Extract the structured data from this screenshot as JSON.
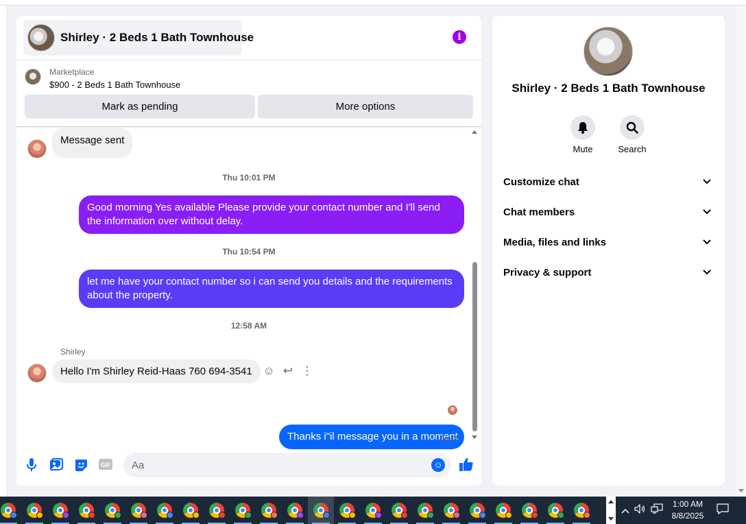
{
  "chat": {
    "title": "Shirley · 2 Beds 1 Bath Townhouse",
    "listing": {
      "category": "Marketplace",
      "price_title": "$900 - 2 Beds 1 Bath Townhouse",
      "mark_pending_label": "Mark as pending",
      "more_options_label": "More options"
    },
    "messages": {
      "first_in": "Message sent",
      "ts1": "Thu 10:01 PM",
      "out1": "Good morning Yes available Please provide your contact number and I'll send the information over without delay.",
      "ts2": "Thu 10:54 PM",
      "out2": "let me have your contact number so i can send you details and the requirements about the property.",
      "ts3": "12:58 AM",
      "sender": "Shirley",
      "in2": "Hello I'm Shirley Reid-Haas 760 694-3541",
      "out3": "Thanks i\"il message you in a moment",
      "sent_status": "Sent"
    },
    "composer": {
      "placeholder": "Aa"
    }
  },
  "info_panel": {
    "title": "Shirley · 2 Beds 1 Bath Townhouse",
    "actions": {
      "mute_label": "Mute",
      "search_label": "Search"
    },
    "sections": {
      "customize": "Customize chat",
      "members": "Chat members",
      "media": "Media, files and links",
      "privacy": "Privacy & support"
    }
  },
  "taskbar": {
    "time": "1:00 AM",
    "date": "8/8/2025"
  },
  "colors": {
    "accent": "#0866ff",
    "out_purple": "#8a1ef5",
    "out_indigo": "#5b3cf6",
    "info_purple": "#a200e6"
  }
}
